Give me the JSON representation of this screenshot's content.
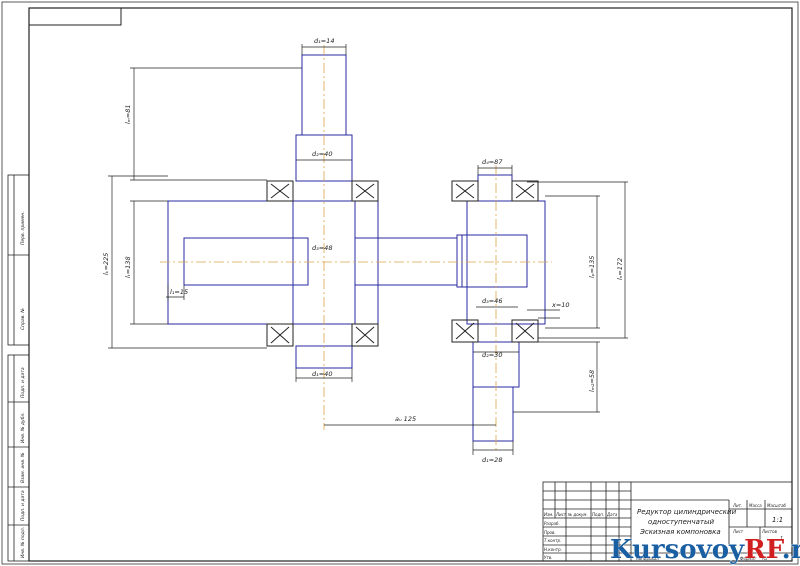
{
  "colors": {
    "part": "#2a2aa0",
    "dim_line": "#222222",
    "axis": "#d9a64a",
    "watermark": "#1b5fa3",
    "watermark_accent": "#d11f1f"
  },
  "dims": {
    "d1_top": "d₁=14",
    "d2_top": "d₂=40",
    "l_m1": "lₘ=81",
    "l_k": "lₖ=225",
    "l_t": "lₜ=138",
    "l1": "l₁=15",
    "d3": "d₃=48",
    "d1_bottom": "d₁=40",
    "a_w": "aᵤ 125",
    "d4_right": "d₄=87",
    "d3_right": "d₃=46",
    "x": "x=10",
    "d2_right": "d₂=30",
    "d1_right": "d₁=28",
    "l_p": "lₚ=135",
    "l_n": "lₙ=172",
    "l_m2": "lₘ₂=58"
  },
  "title_block": {
    "title_line1": "Редуктор цилиндрический",
    "title_line2": "одноступенчатый",
    "title_line3": "Эскизная компоновка",
    "col_lit": "Лит.",
    "col_mass": "Масса",
    "col_scale": "Масштаб",
    "scale_value": "1:1",
    "sheet_label": "Лист",
    "sheets_label": "Листов",
    "sheets_value": "1",
    "izm": "Изм.",
    "list": "Лист",
    "doc": "№ докум.",
    "sign": "Подп.",
    "date": "Дата",
    "razrab": "Разраб.",
    "prov": "Пров.",
    "tkontr": "Т.контр.",
    "nkontr": "Н.контр.",
    "utv": "Утв.",
    "kopiroval": "Копировал",
    "format": "Формат",
    "format_value": "A3"
  },
  "side_stamps": [
    "Перв. примен.",
    "Справ. №",
    "Подп. и дата",
    "Инв. № дубл.",
    "Взам. инв. №",
    "Подп. и дата",
    "Инв. № подл."
  ],
  "watermark": {
    "brand": "KursovoyRF",
    "accent": "RF",
    "prefix": "Kursovoy",
    "suffix": ".ru"
  }
}
